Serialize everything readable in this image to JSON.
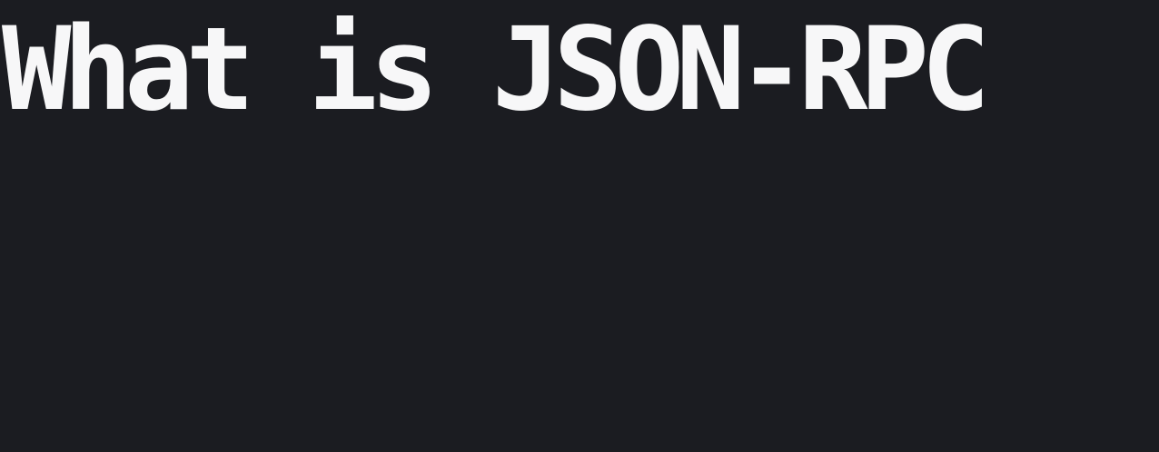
{
  "slide": {
    "title": "What is JSON-RPC",
    "background_color": "#1b1c21",
    "text_color": "#f7f7f8"
  }
}
